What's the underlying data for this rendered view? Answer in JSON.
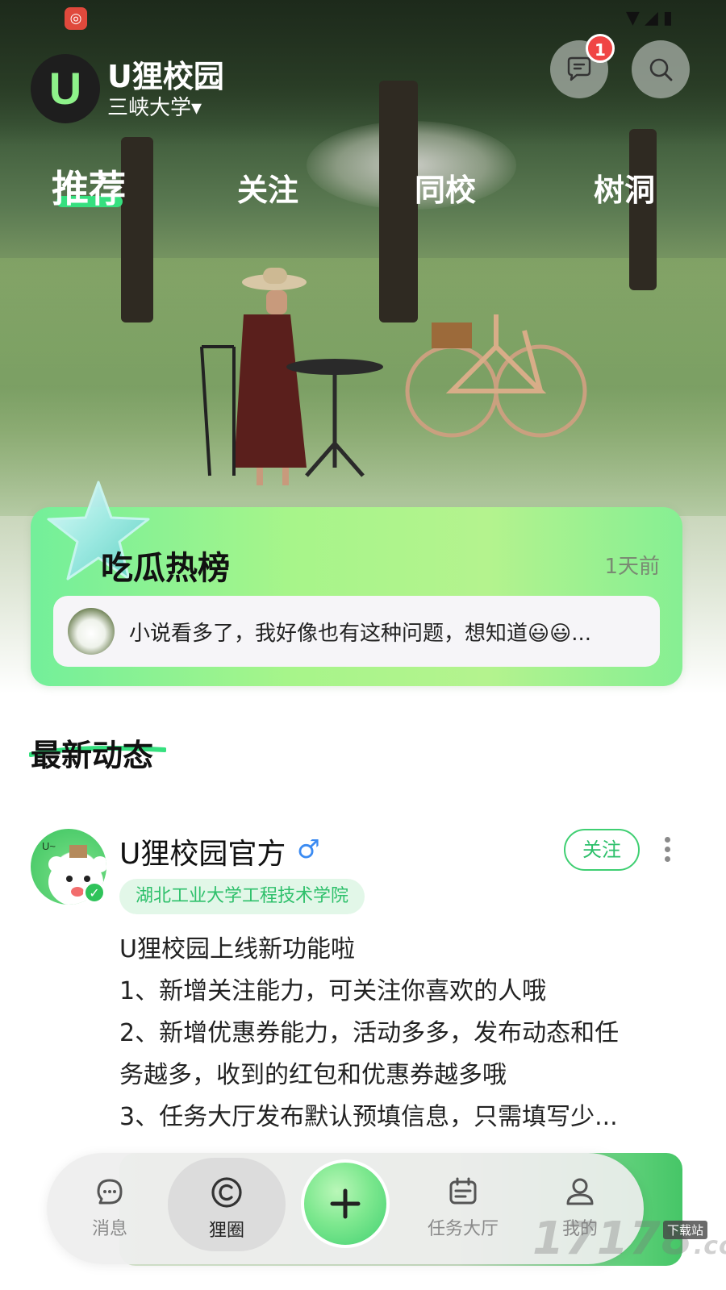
{
  "header": {
    "app_name": "U狸校园",
    "school": "三峡大学",
    "school_caret": "▾",
    "logo_letter": "U",
    "message_badge": "1"
  },
  "tabs": [
    {
      "label": "推荐",
      "active": true
    },
    {
      "label": "关注",
      "active": false
    },
    {
      "label": "同校",
      "active": false
    },
    {
      "label": "树洞",
      "active": false
    }
  ],
  "hot_list": {
    "title": "吃瓜热榜",
    "time": "1天前",
    "item_text": "小说看多了，我好像也有这种问题，想知道😃😃..."
  },
  "latest": {
    "title": "最新动态"
  },
  "post": {
    "author": "U狸校园官方",
    "gender_symbol": "♂",
    "school_tag": "湖北工业大学工程技术学院",
    "follow_label": "关注",
    "lines": [
      "U狸校园上线新功能啦",
      "1、新增关注能力，可关注你喜欢的人哦",
      "2、新增优惠券能力，活动多多，发布动态和任",
      "务越多，收到的红包和优惠券越多哦",
      "3、任务大厅发布默认预填信息，只需填写少..."
    ]
  },
  "bottom_nav": [
    {
      "label": "消息",
      "icon": "chat-bubble-icon"
    },
    {
      "label": "狸圈",
      "icon": "circle-c-icon",
      "active": true
    },
    {
      "label": "任务大厅",
      "icon": "calendar-list-icon"
    },
    {
      "label": "我的",
      "icon": "person-icon"
    }
  ],
  "watermark": {
    "text": "17178",
    "tag": "下载站",
    "suffix": ".com"
  },
  "colors": {
    "accent": "#36e07f",
    "badge": "#f04545",
    "tag_text": "#2ec06b"
  }
}
